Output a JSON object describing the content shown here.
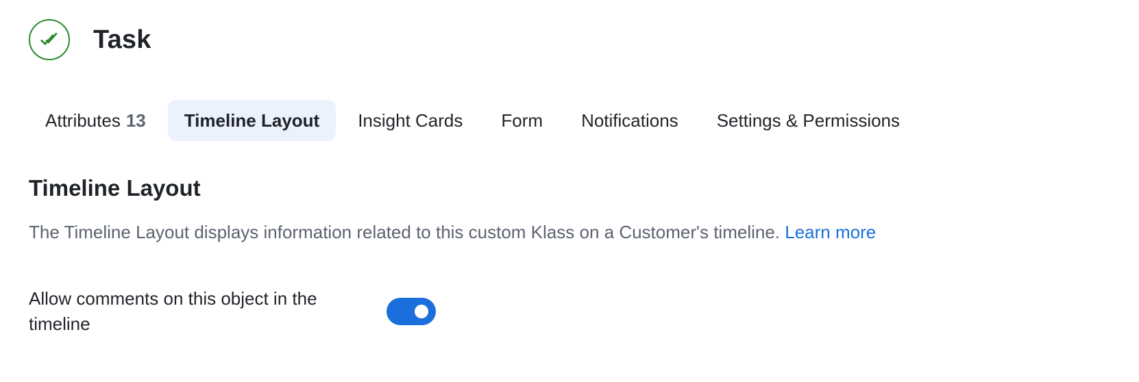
{
  "header": {
    "icon": "check-double-icon",
    "icon_color": "#2a8a2a",
    "title": "Task"
  },
  "tabs": [
    {
      "label": "Attributes",
      "count": "13",
      "active": false
    },
    {
      "label": "Timeline Layout",
      "active": true
    },
    {
      "label": "Insight Cards",
      "active": false
    },
    {
      "label": "Form",
      "active": false
    },
    {
      "label": "Notifications",
      "active": false
    },
    {
      "label": "Settings & Permissions",
      "active": false
    }
  ],
  "section": {
    "title": "Timeline Layout",
    "description": "The Timeline Layout displays information related to this custom Klass on a Customer's timeline.",
    "learn_more": "Learn more"
  },
  "settings": {
    "allow_comments": {
      "label": "Allow comments on this object in the timeline",
      "enabled": true
    }
  },
  "colors": {
    "accent": "#1a6fdc",
    "active_tab_bg": "#ebf1fd",
    "success": "#2a8a2a"
  }
}
